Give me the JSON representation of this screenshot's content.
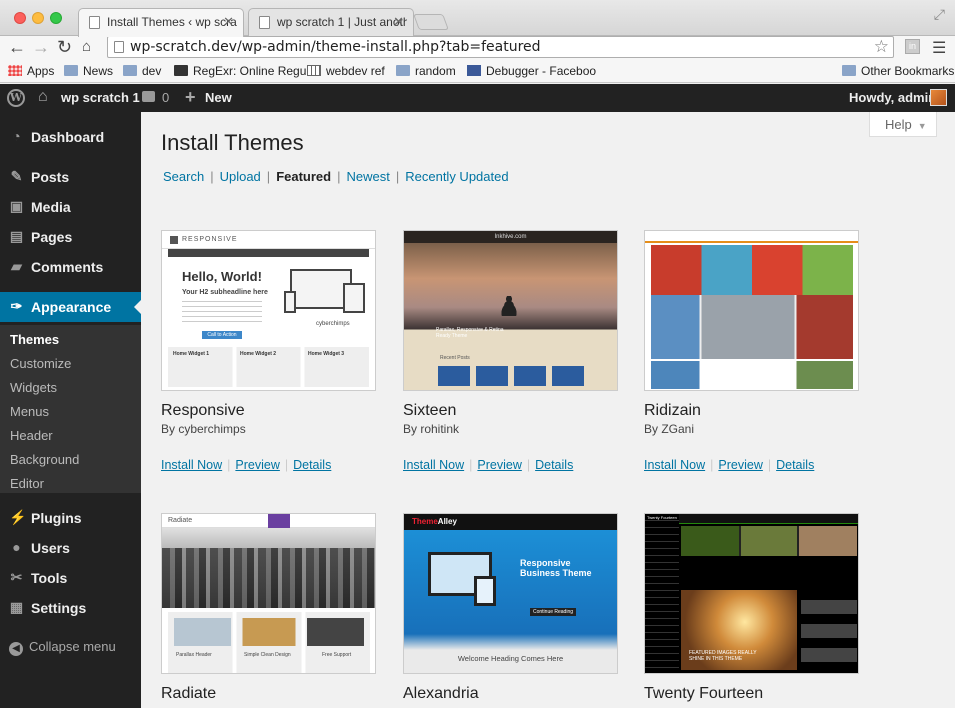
{
  "browser": {
    "tabs": [
      {
        "title": "Install Themes ‹ wp scratch"
      },
      {
        "title": "wp scratch 1 | Just another"
      }
    ],
    "url": "wp-scratch.dev/wp-admin/theme-install.php?tab=featured",
    "bookmarks": [
      {
        "label": "Apps",
        "icon": "apps-icon"
      },
      {
        "label": "News",
        "icon": "folder-icon"
      },
      {
        "label": "dev",
        "icon": "folder-icon"
      },
      {
        "label": "RegExr: Online Regu",
        "icon": "regexr-icon"
      },
      {
        "label": "webdev ref",
        "icon": "grid-icon"
      },
      {
        "label": "random",
        "icon": "folder-icon"
      },
      {
        "label": "Debugger - Faceboo",
        "icon": "facebook-icon"
      },
      {
        "label": "Other Bookmarks",
        "icon": "folder-icon"
      }
    ]
  },
  "admin_bar": {
    "site_name": "wp scratch 1",
    "comments_count": "0",
    "new_label": "New",
    "greeting": "Howdy, admin"
  },
  "admin_menu": {
    "items": [
      {
        "label": "Dashboard",
        "icon": "dashboard-icon"
      },
      {
        "label": "Posts",
        "icon": "pin-icon"
      },
      {
        "label": "Media",
        "icon": "media-icon"
      },
      {
        "label": "Pages",
        "icon": "pages-icon"
      },
      {
        "label": "Comments",
        "icon": "comment-icon"
      },
      {
        "label": "Appearance",
        "icon": "brush-icon"
      },
      {
        "label": "Plugins",
        "icon": "plug-icon"
      },
      {
        "label": "Users",
        "icon": "users-icon"
      },
      {
        "label": "Tools",
        "icon": "wrench-icon"
      },
      {
        "label": "Settings",
        "icon": "settings-icon"
      }
    ],
    "appearance_submenu": [
      "Themes",
      "Customize",
      "Widgets",
      "Menus",
      "Header",
      "Background",
      "Editor"
    ],
    "collapse_label": "Collapse menu"
  },
  "help_label": "Help",
  "page_title": "Install Themes",
  "filters": [
    "Search",
    "Upload",
    "Featured",
    "Newest",
    "Recently Updated"
  ],
  "current_filter": "Featured",
  "themes": [
    {
      "name": "Responsive",
      "author": "By cyberchimps"
    },
    {
      "name": "Sixteen",
      "author": "By rohitink"
    },
    {
      "name": "Ridizain",
      "author": "By ZGani"
    },
    {
      "name": "Radiate",
      "author": ""
    },
    {
      "name": "Alexandria",
      "author": ""
    },
    {
      "name": "Twenty Fourteen",
      "author": ""
    }
  ],
  "theme_actions": {
    "install": "Install Now",
    "preview": "Preview",
    "details": "Details"
  },
  "thumbnails": {
    "responsive": {
      "brand": "RESPONSIVE",
      "heading": "Hello, World!",
      "subheading": "Your H2 subheadline here",
      "button": "Call to Action",
      "footer": "cyberchimps",
      "widgets": [
        "Home Widget 1",
        "Home Widget 2",
        "Home Widget 3"
      ]
    },
    "sixteen": {
      "site": "Inkhive.com",
      "caption": "Parallax, Responsive & Retina Ready Theme",
      "section": "Recent Posts"
    },
    "radiate": {
      "brand": "Radiate",
      "cards": [
        "Parallax Header",
        "Simple Clean Design",
        "Free Support"
      ]
    },
    "alexandria": {
      "brand_a": "Theme",
      "brand_b": "Alley",
      "heading": "Responsive Business Theme",
      "button": "Continue Reading",
      "footer": "Welcome Heading Comes Here"
    },
    "twentyfourteen": {
      "brand": "Twenty Fourteen",
      "hero_text": "FEATURED IMAGES REALLY SHINE IN THIS THEME"
    }
  },
  "colors": {
    "admin_bar": "#222222",
    "menu_current": "#0074a2",
    "link": "#0074a2",
    "background": "#f1f1f1"
  }
}
